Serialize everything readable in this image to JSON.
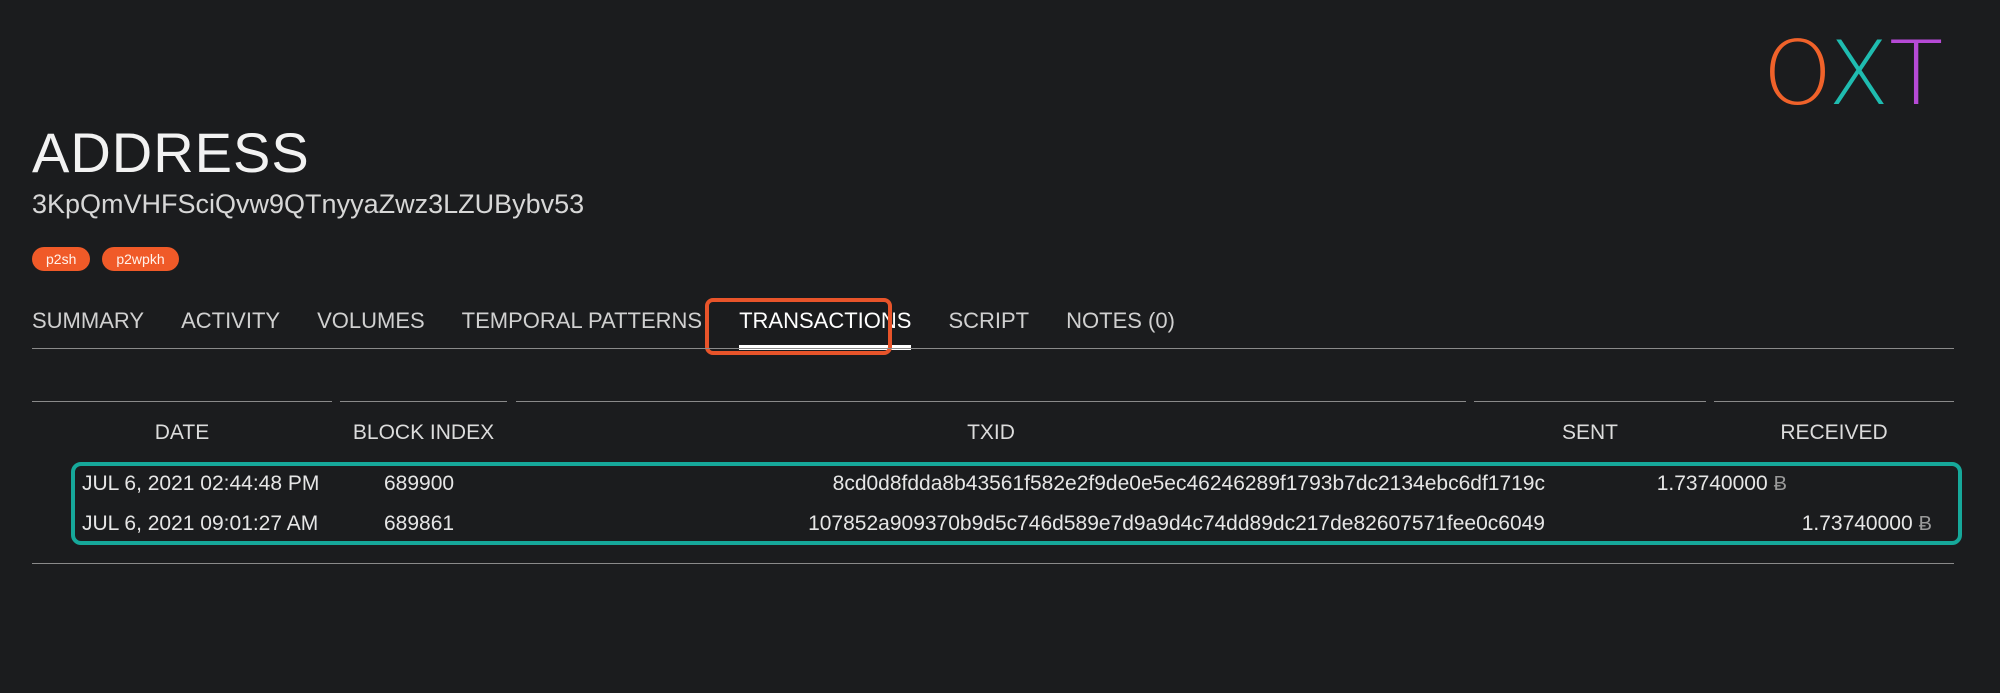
{
  "logo": {
    "o": "O",
    "x": "X",
    "t": "T"
  },
  "page": {
    "title": "ADDRESS",
    "address": "3KpQmVHFSciQvw9QTnyyaZwz3LZUBybv53",
    "tags": [
      "p2sh",
      "p2wpkh"
    ]
  },
  "tabs": [
    {
      "label": "SUMMARY"
    },
    {
      "label": "ACTIVITY"
    },
    {
      "label": "VOLUMES"
    },
    {
      "label": "TEMPORAL PATTERNS"
    },
    {
      "label": "TRANSACTIONS",
      "active": true
    },
    {
      "label": "SCRIPT"
    },
    {
      "label": "NOTES (0)"
    }
  ],
  "table": {
    "headers": {
      "date": "DATE",
      "block_index": "BLOCK INDEX",
      "txid": "TXID",
      "sent": "SENT",
      "received": "RECEIVED"
    },
    "rows": [
      {
        "date": "JUL 6, 2021 02:44:48 PM",
        "block_index": "689900",
        "txid": "8cd0d8fdda8b43561f582e2f9de0e5ec46246289f1793b7dc2134ebc6df1719c",
        "sent": "1.73740000",
        "received": ""
      },
      {
        "date": "JUL 6, 2021 09:01:27 AM",
        "block_index": "689861",
        "txid": "107852a909370b9d5c746d589e7d9a9d4c74dd89dc217de82607571fee0c6049",
        "sent": "",
        "received": "1.73740000"
      }
    ],
    "currency_symbol": "Ƀ"
  },
  "colors": {
    "background": "#1b1c1e",
    "tag": "#f05a28",
    "tab_highlight": "#e8542a",
    "rows_highlight": "#16a89a",
    "logo_o": "#f0622a",
    "logo_x": "#1fbcb0",
    "logo_t": "#b64ad6"
  }
}
